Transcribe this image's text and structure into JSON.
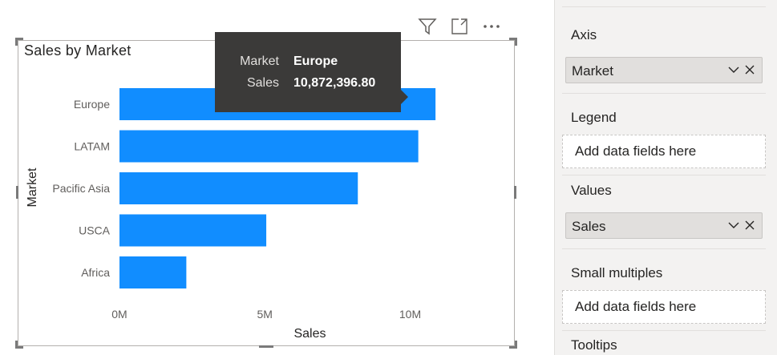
{
  "visual": {
    "title": "Sales by Market",
    "header_icons": [
      "filter-icon",
      "focus-mode-icon",
      "more-options-icon"
    ]
  },
  "chart_data": {
    "type": "bar",
    "orientation": "horizontal",
    "title": "Sales by Market",
    "xlabel": "Sales",
    "ylabel": "Market",
    "categories": [
      "Europe",
      "LATAM",
      "Pacific Asia",
      "USCA",
      "Africa"
    ],
    "values": [
      10872396.8,
      10280000,
      8200000,
      5050000,
      2300000
    ],
    "xlim": [
      0,
      12000000
    ],
    "xticks": [
      0,
      5000000,
      10000000
    ],
    "xtick_labels": [
      "0M",
      "5M",
      "10M"
    ],
    "grid": false,
    "bar_color": "#118DFF"
  },
  "tooltip": {
    "rows": [
      {
        "key": "Market",
        "value": "Europe"
      },
      {
        "key": "Sales",
        "value": "10,872,396.80"
      }
    ]
  },
  "pane": {
    "axis": {
      "title": "Axis",
      "field": "Market"
    },
    "legend": {
      "title": "Legend",
      "placeholder": "Add data fields here"
    },
    "values": {
      "title": "Values",
      "field": "Sales"
    },
    "small_multiples": {
      "title": "Small multiples",
      "placeholder": "Add data fields here"
    },
    "tooltips": {
      "title": "Tooltips"
    }
  }
}
